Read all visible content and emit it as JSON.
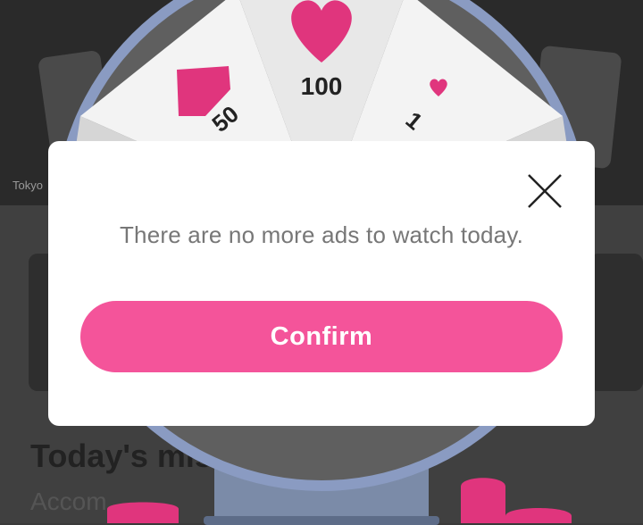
{
  "background": {
    "tokyo_label": "Tokyo",
    "mission_title": "Today's mis",
    "mission_subtitle": "Accom"
  },
  "wheel": {
    "segments": [
      {
        "label": "100"
      },
      {
        "label": "50"
      },
      {
        "label": "1"
      }
    ]
  },
  "modal": {
    "message": "There are no more ads to watch today.",
    "confirm_label": "Confirm"
  },
  "colors": {
    "accent": "#f4549a",
    "heart": "#e0357d",
    "modal_bg": "#ffffff",
    "message_text": "#777777"
  },
  "icons": {
    "close": "close-icon",
    "heart": "heart-icon"
  }
}
